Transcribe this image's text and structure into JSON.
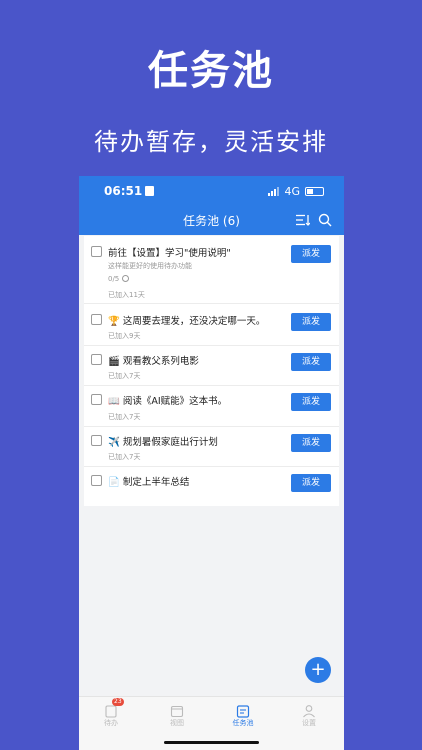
{
  "promo": {
    "title": "任务池",
    "subtitle": "待办暂存，灵活安排"
  },
  "status": {
    "time": "06:51",
    "network": "4G"
  },
  "nav": {
    "title": "任务池 (6)",
    "sort_icon": "sort-icon",
    "search_icon": "search-icon"
  },
  "tasks": [
    {
      "title": "前往【设置】学习\"使用说明\"",
      "desc": "这样能更好的使用待办功能",
      "progress": "0/5",
      "added": "已加入11天",
      "button": "派发"
    },
    {
      "title": "🏆 这周要去理发，还没决定哪一天。",
      "added": "已加入9天",
      "button": "派发"
    },
    {
      "title": "🎬 观看教父系列电影",
      "added": "已加入7天",
      "button": "派发"
    },
    {
      "title": "📖 阅读《AI赋能》这本书。",
      "added": "已加入7天",
      "button": "派发"
    },
    {
      "title": "✈️ 规划暑假家庭出行计划",
      "added": "已加入7天",
      "button": "派发"
    },
    {
      "title": "📄 制定上半年总结",
      "added": "",
      "button": "派发"
    }
  ],
  "fab": {
    "label": "+"
  },
  "tabbar": {
    "tabs": [
      {
        "label": "待办",
        "badge": "23"
      },
      {
        "label": "视图",
        "icon_text": "30"
      },
      {
        "label": "任务池"
      },
      {
        "label": "设置"
      }
    ]
  },
  "colors": {
    "background": "#4a55c9",
    "accent": "#2c7be5"
  }
}
